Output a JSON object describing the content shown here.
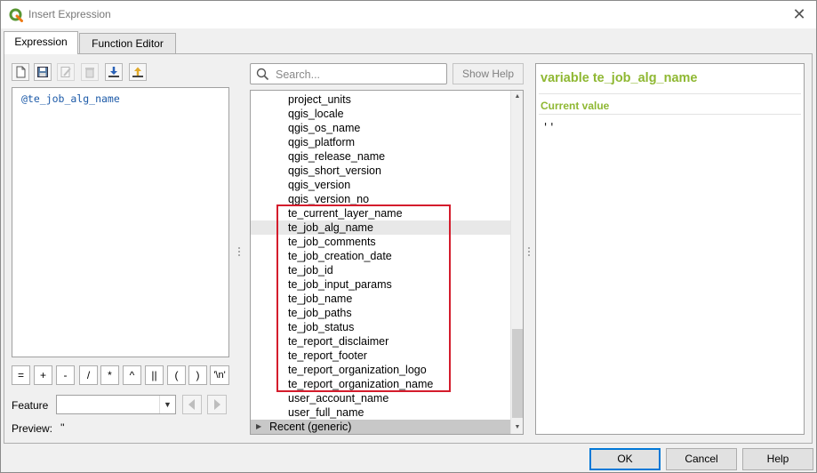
{
  "window": {
    "title": "Insert Expression"
  },
  "tabs": [
    {
      "label": "Expression"
    },
    {
      "label": "Function Editor"
    }
  ],
  "toolbar": {
    "icons": [
      "new-file-icon",
      "save-icon",
      "edit-icon",
      "delete-icon",
      "import-icon",
      "export-icon"
    ]
  },
  "editor": {
    "text": "@te_job_alg_name"
  },
  "operators": [
    "=",
    "+",
    "-",
    "/",
    "*",
    "^",
    "||",
    "(",
    ")",
    "'\\n'"
  ],
  "feature": {
    "label": "Feature",
    "value": ""
  },
  "preview": {
    "label": "Preview:",
    "value": "''"
  },
  "search": {
    "placeholder": "Search..."
  },
  "show_help": {
    "label": "Show Help"
  },
  "tree": {
    "items": [
      "project_units",
      "qgis_locale",
      "qgis_os_name",
      "qgis_platform",
      "qgis_release_name",
      "qgis_short_version",
      "qgis_version",
      "qgis_version_no",
      "te_current_layer_name",
      "te_job_alg_name",
      "te_job_comments",
      "te_job_creation_date",
      "te_job_id",
      "te_job_input_params",
      "te_job_name",
      "te_job_paths",
      "te_job_status",
      "te_report_disclaimer",
      "te_report_footer",
      "te_report_organization_logo",
      "te_report_organization_name",
      "user_account_name",
      "user_full_name"
    ],
    "selected": "te_job_alg_name",
    "group": "Recent (generic)"
  },
  "help": {
    "title": "variable te_job_alg_name",
    "subtitle": "Current value",
    "value": "''"
  },
  "buttons": {
    "ok": "OK",
    "cancel": "Cancel",
    "help": "Help"
  },
  "colors": {
    "help_heading": "#8fb833",
    "highlight_box": "#d41c2c",
    "editor_text": "#1c5aa8"
  }
}
